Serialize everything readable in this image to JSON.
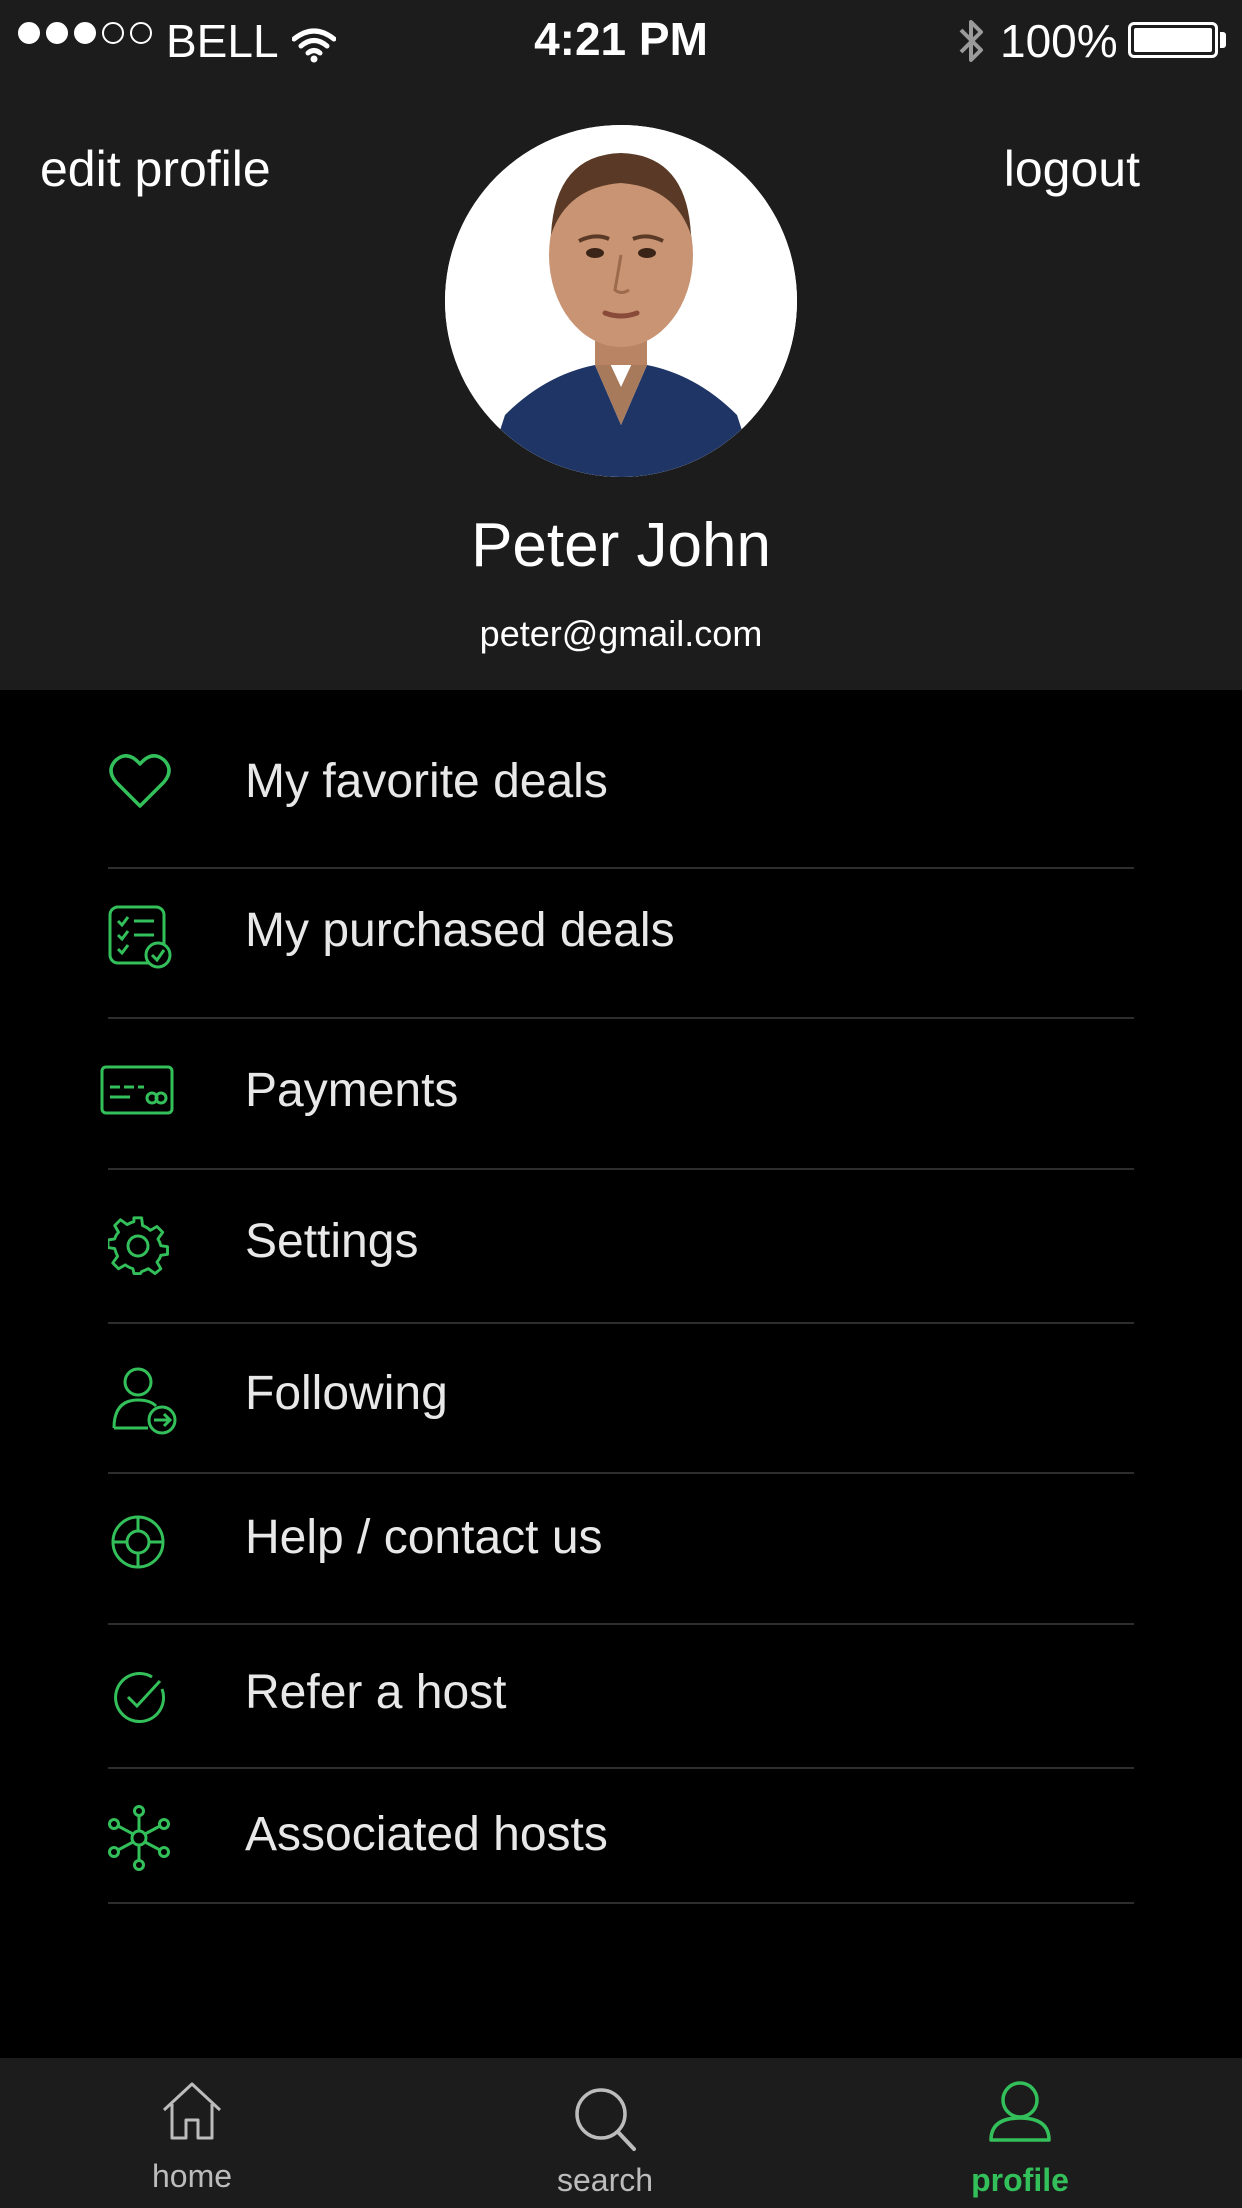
{
  "status_bar": {
    "carrier": "BELL",
    "time": "4:21 PM",
    "battery": "100%"
  },
  "header": {
    "edit_profile": "edit profile",
    "logout": "logout",
    "name": "Peter John",
    "email": "peter@gmail.com"
  },
  "menu": {
    "items": [
      {
        "label": "My favorite deals",
        "icon": "heart-icon"
      },
      {
        "label": "My purchased deals",
        "icon": "checklist-icon"
      },
      {
        "label": "Payments",
        "icon": "credit-card-icon"
      },
      {
        "label": "Settings",
        "icon": "gear-icon"
      },
      {
        "label": "Following",
        "icon": "user-follow-icon"
      },
      {
        "label": "Help / contact us",
        "icon": "lifebuoy-icon"
      },
      {
        "label": "Refer a host",
        "icon": "check-circle-icon"
      },
      {
        "label": "Associated hosts",
        "icon": "network-icon"
      }
    ]
  },
  "tabbar": {
    "tabs": [
      {
        "label": "home",
        "icon": "home-icon",
        "active": false
      },
      {
        "label": "search",
        "icon": "search-icon",
        "active": false
      },
      {
        "label": "profile",
        "icon": "profile-icon",
        "active": true
      }
    ]
  },
  "colors": {
    "accent": "#33c05a",
    "header_bg": "#1c1c1c",
    "background": "#000000"
  }
}
